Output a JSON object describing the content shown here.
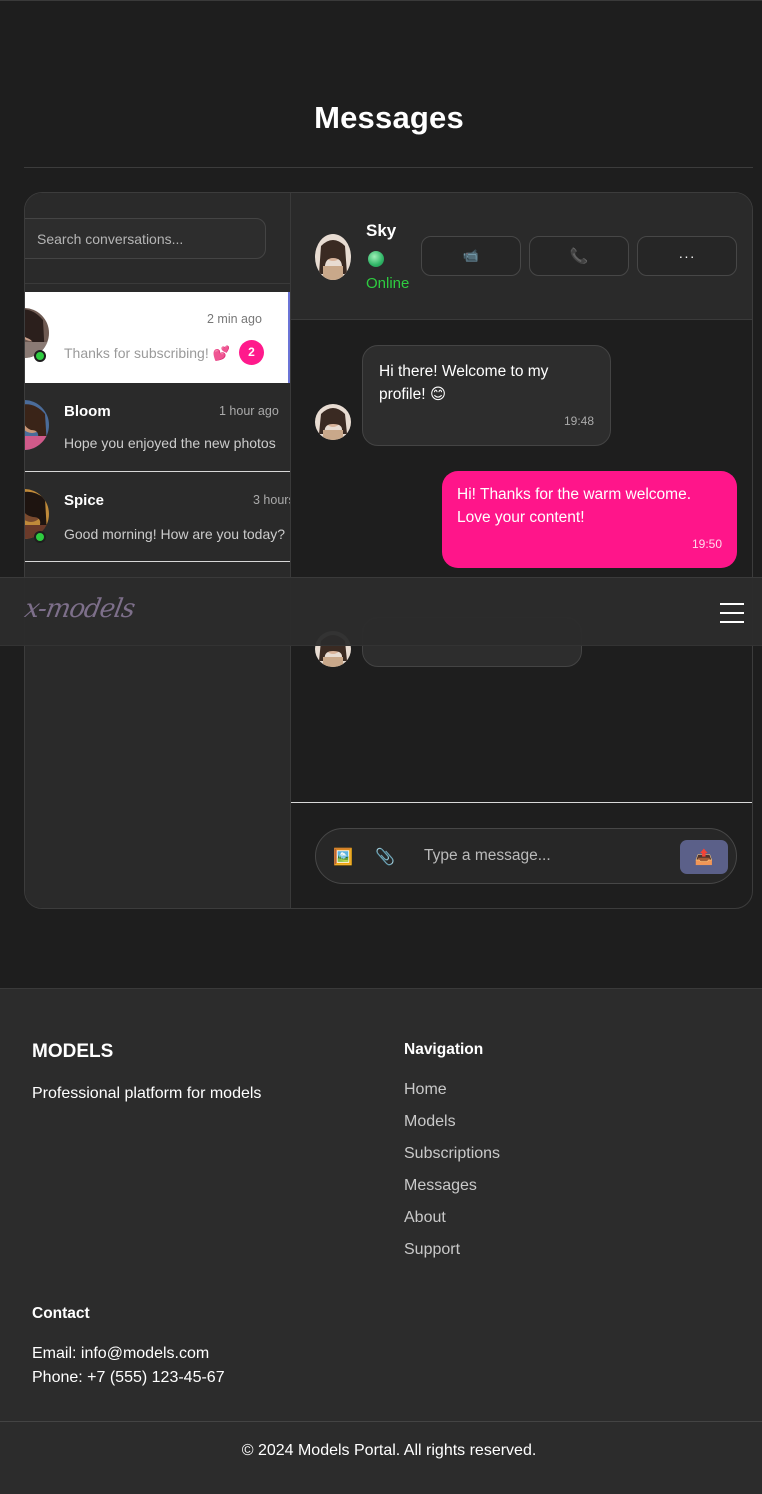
{
  "page": {
    "title": "Messages"
  },
  "sidebar": {
    "search_placeholder": "Search conversations...",
    "conversations": [
      {
        "name": "",
        "time": "2 min ago",
        "preview": "Thanks for subscribing! 💕",
        "unread": "2",
        "online": true,
        "active": true
      },
      {
        "name": "Bloom",
        "time": "1 hour ago",
        "preview": "Hope you enjoyed the new photos",
        "online": false,
        "active": false
      },
      {
        "name": "Spice",
        "time": "3 hours",
        "preview": "Good morning! How are you today?",
        "online": true,
        "active": false
      }
    ]
  },
  "chat": {
    "contact_name": "Sky",
    "status": "Online",
    "actions": {
      "video_icon": "📹",
      "call_icon": "📞",
      "more_label": "···"
    },
    "messages": [
      {
        "direction": "in",
        "text": "Hi there! Welcome to my profile! 😊",
        "time": "19:48"
      },
      {
        "direction": "out",
        "text": "Hi! Thanks for the warm welcome. Love your content!",
        "time": "19:50"
      }
    ],
    "composer": {
      "placeholder": "Type a message...",
      "image_icon": "🖼️",
      "attach_icon": "📎",
      "send_icon": "📤"
    }
  },
  "navbar": {
    "logo": "x-models"
  },
  "footer": {
    "brand": "MODELS",
    "description": "Professional platform for models",
    "navigation_title": "Navigation",
    "navigation": [
      "Home",
      "Models",
      "Subscriptions",
      "Messages",
      "About",
      "Support"
    ],
    "contact_title": "Contact",
    "email": "Email: info@models.com",
    "phone": "Phone: +7 (555) 123-45-67",
    "copyright": "© 2024 Models Portal. All rights reserved."
  },
  "colors": {
    "accent": "#ff158a",
    "online": "#2ecc40",
    "background": "#1e1e1e",
    "panel": "#2a2a2a",
    "send_button": "#5b6089"
  }
}
